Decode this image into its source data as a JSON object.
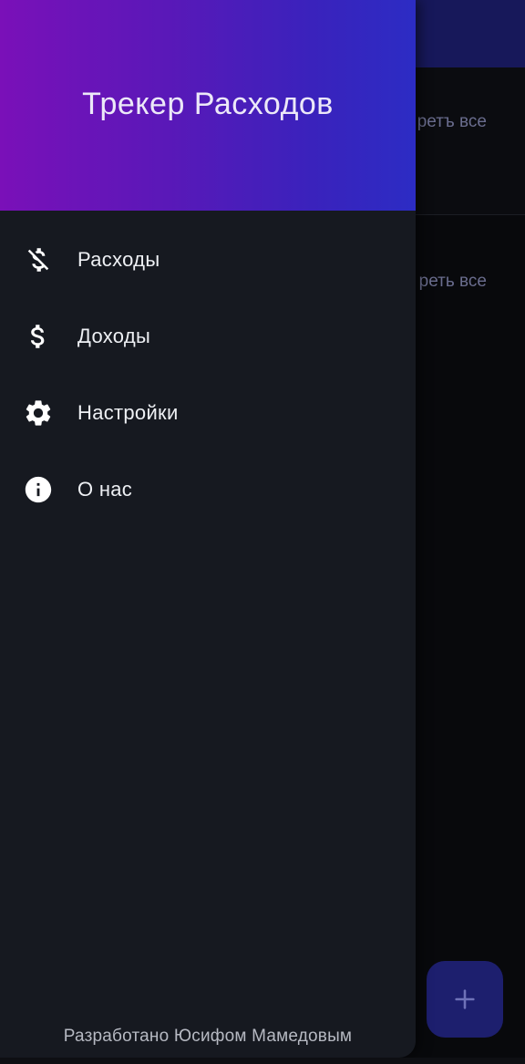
{
  "background": {
    "link_1": "ретъ все",
    "link_2": "реть все",
    "fab_icon": "plus-icon"
  },
  "drawer": {
    "title": "Трекер Расходов",
    "items": [
      {
        "label": "Расходы",
        "icon": "money-off-icon"
      },
      {
        "label": "Доходы",
        "icon": "dollar-icon"
      },
      {
        "label": "Настройки",
        "icon": "gear-icon"
      },
      {
        "label": "О нас",
        "icon": "info-icon"
      }
    ],
    "footer": "Разработано Юсифом Мамедовым"
  },
  "colors": {
    "header_gradient_start": "#7a10b8",
    "header_gradient_end": "#2c2cc4",
    "drawer_bg": "#161920",
    "fab_bg": "#1d1f6e"
  }
}
